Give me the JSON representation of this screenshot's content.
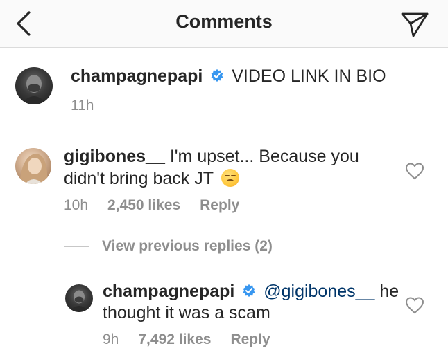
{
  "header": {
    "title": "Comments",
    "back_icon": "chevron-left-icon",
    "send_icon": "paper-plane-icon"
  },
  "caption": {
    "username": "champagnepapi",
    "text": "VIDEO LINK IN BIO",
    "time": "11h"
  },
  "comment": {
    "username": "gigibones__",
    "text_line1": "I'm upset... Because you",
    "text_line2": "didn't bring back JT",
    "emoji": "unamused-face-emoji",
    "time": "10h",
    "likes": "2,450 likes",
    "reply_label": "Reply"
  },
  "view_replies": {
    "label": "View previous replies (2)"
  },
  "reply": {
    "username": "champagnepapi",
    "mention": "@gigibones__",
    "text_line1_rest": "he",
    "text_line2": "thought it was a scam",
    "time": "9h",
    "likes": "7,492 likes",
    "reply_label": "Reply"
  },
  "colors": {
    "verified": "#3897f0",
    "mention": "#003569",
    "secondary_text": "#8e8e8e",
    "divider": "#dbdbdb"
  }
}
